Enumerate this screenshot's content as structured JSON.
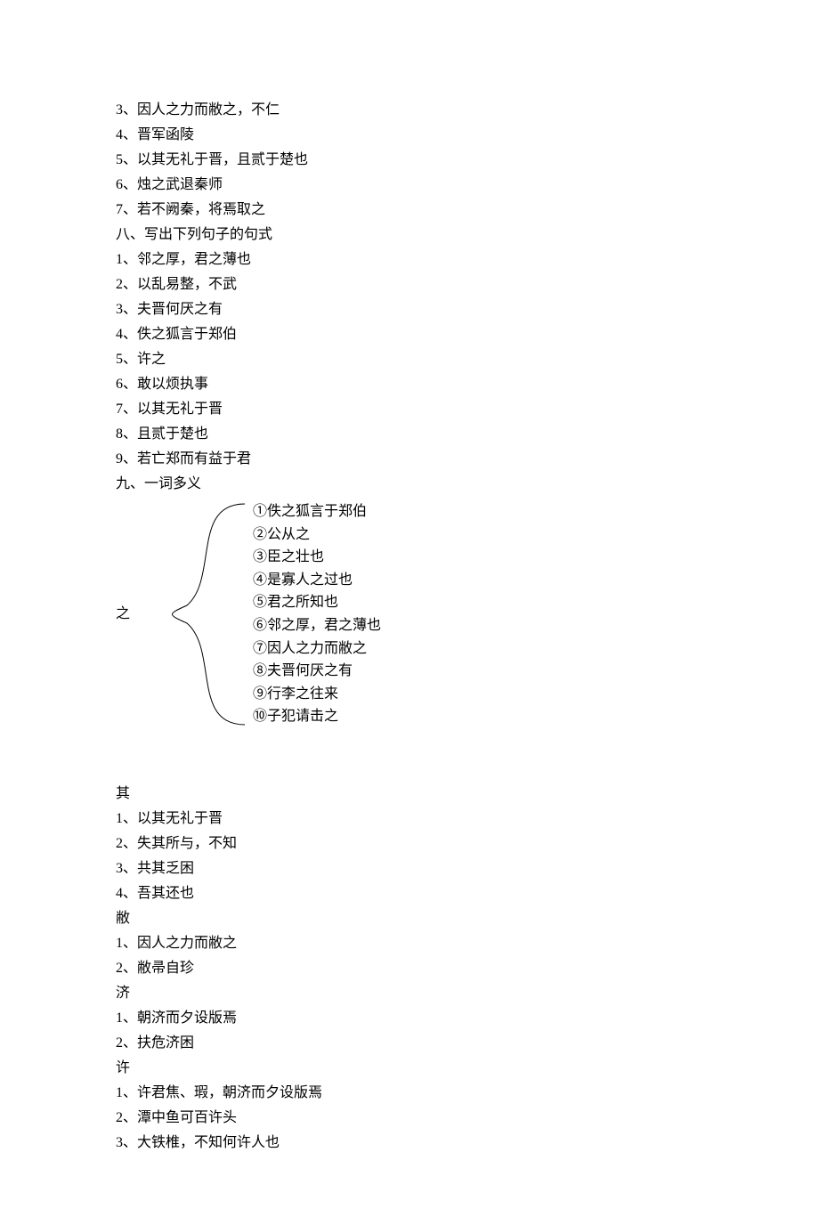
{
  "lines_top": [
    "3、因人之力而敝之，不仁",
    "4、晋军函陵",
    "5、以其无礼于晋，且贰于楚也",
    "6、烛之武退秦师",
    "7、若不阙秦，将焉取之",
    "八、写出下列句子的句式",
    "1、邻之厚，君之薄也",
    "2、以乱易整，不武",
    "3、夫晋何厌之有",
    "4、佚之狐言于郑伯",
    "5、许之",
    "6、敢以烦执事",
    "7、以其无礼于晋",
    "8、且贰于楚也",
    "9、若亡郑而有益于君",
    "九、一词多义"
  ],
  "zhi_char": "之",
  "zhi_items": [
    "①佚之狐言于郑伯",
    "②公从之",
    "③臣之壮也",
    "④是寡人之过也",
    "⑤君之所知也",
    "⑥邻之厚，君之薄也",
    "⑦因人之力而敝之",
    "⑧夫晋何厌之有",
    "⑨行李之往来",
    "⑩子犯请击之"
  ],
  "lines_bottom": [
    "其",
    "1、以其无礼于晋",
    "2、失其所与，不知",
    "3、共其乏困",
    "4、吾其还也",
    "敝",
    "1、因人之力而敝之",
    "2、敝帚自珍",
    "济",
    "1、朝济而夕设版焉",
    "2、扶危济困",
    "许",
    "1、许君焦、瑕，朝济而夕设版焉",
    "2、潭中鱼可百许头",
    "3、大铁椎，不知何许人也"
  ]
}
